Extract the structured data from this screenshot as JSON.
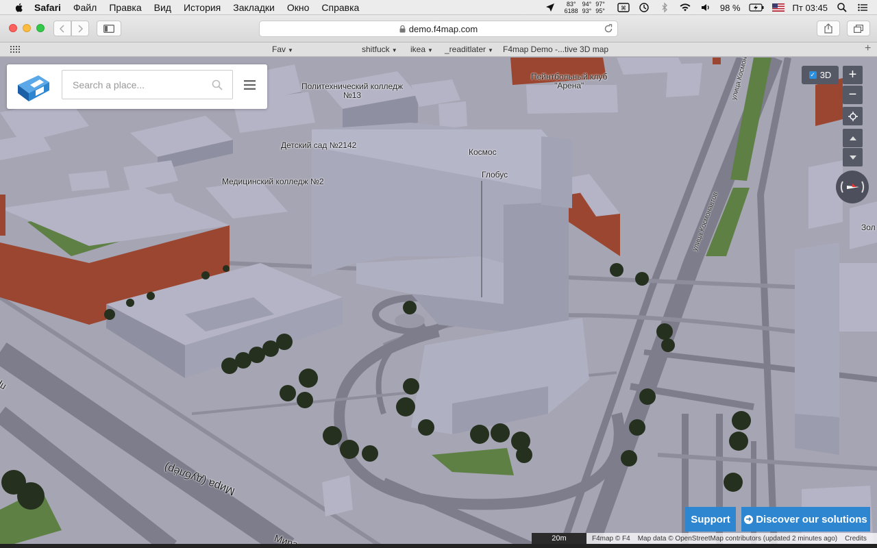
{
  "menubar": {
    "apple_icon": "apple-logo-icon",
    "items": [
      "Safari",
      "Файл",
      "Правка",
      "Вид",
      "История",
      "Закладки",
      "Окно",
      "Справка"
    ],
    "temps": [
      [
        "83°",
        "6188"
      ],
      [
        "94°",
        "93°"
      ],
      [
        "97°",
        "95°"
      ]
    ],
    "battery": "98 %",
    "clock": "Пт 03:45",
    "input_flag": "us-flag-icon"
  },
  "browser": {
    "url": "demo.f4map.com",
    "bookmarks": [
      {
        "label": "Fav",
        "dropdown": true
      },
      {
        "label": "shitfuck",
        "dropdown": true
      },
      {
        "label": "ikea",
        "dropdown": true
      },
      {
        "label": "_readitlater",
        "dropdown": true
      },
      {
        "label": "F4map Demo -...tive 3D map",
        "dropdown": false
      }
    ],
    "new_tab_symbol": "+"
  },
  "search": {
    "placeholder": "Search a place..."
  },
  "map_labels": {
    "poly_college_1": "Политехнический колледж",
    "poly_college_2": "№13",
    "paintball_1": "Пейнтбольный клуб",
    "paintball_2": "\"Арена\"",
    "kindergarten": "Детский сад №2142",
    "kosmos": "Космос",
    "globus": "Глобус",
    "medical_college": "Медицинский колледж №2",
    "zol": "Зол",
    "street_mira_1": "Мира (дублёр)",
    "street_mira_2": "Мира",
    "street_kosmonavtov_1": "улица Космонавтов",
    "street_kosmonavtov_2": "улица Космонавтов",
    "street_prosp": "проспе"
  },
  "controls": {
    "toggle_3d_label": "3D",
    "zoom_in": "+",
    "zoom_out": "−"
  },
  "footer": {
    "support_label": "Support",
    "discover_label": "Discover our solutions",
    "scale": "20m",
    "credit_f4": "F4map © F4",
    "credit_osm": "Map data © OpenStreetMap contributors (updated 2 minutes ago)",
    "credits_link": "Credits"
  },
  "colors": {
    "ground": "#a6a5b3",
    "building_top": "#b4b4c6",
    "building_side": "#8f8fa2",
    "brick": "#9b4630",
    "grass": "#5e8044",
    "tree": "#25301f",
    "accent_blue": "#2d86cf"
  }
}
